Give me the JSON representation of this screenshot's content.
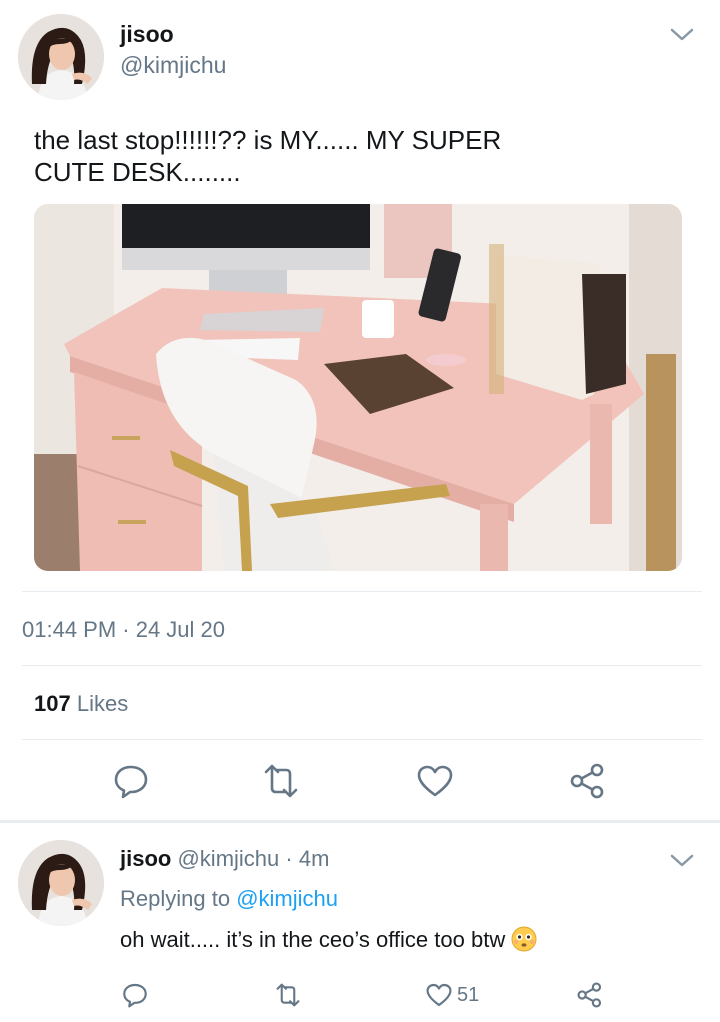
{
  "tweet": {
    "display_name": "jisoo",
    "handle": "@kimjichu",
    "text": "the last stop!!!!!!?? is MY......  MY SUPER CUTE DESK........",
    "timestamp": "01:44 PM · 24 Jul 20",
    "likes_count": "107",
    "likes_label": "Likes",
    "menu_icon": "chevron-down-icon"
  },
  "actions": [
    {
      "name": "reply",
      "icon": "comment-icon"
    },
    {
      "name": "retweet",
      "icon": "retweet-icon"
    },
    {
      "name": "like",
      "icon": "heart-icon"
    },
    {
      "name": "share",
      "icon": "share-icon"
    }
  ],
  "reply": {
    "display_name": "jisoo",
    "handle": "@kimjichu",
    "age": "· 4m",
    "replying_prefix": "Replying to",
    "replying_to": "@kimjichu",
    "text": "oh wait..... it’s in the ceo’s office too btw",
    "emoji": "flushed-face",
    "like_count": "51"
  },
  "colors": {
    "text": "#14171a",
    "secondary": "#657786",
    "link": "#1da1f2",
    "divider": "#e6ecf0",
    "icon": "#657786"
  }
}
